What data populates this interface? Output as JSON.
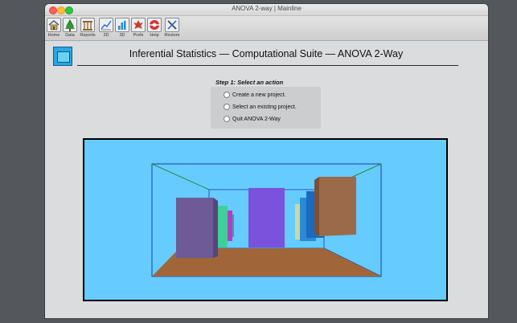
{
  "window": {
    "title": "ANOVA 2-way | Mainline"
  },
  "toolbar": {
    "items": [
      {
        "label": "Home",
        "icon": "home-icon"
      },
      {
        "label": "Data",
        "icon": "tree-icon"
      },
      {
        "label": "Reports",
        "icon": "columns-icon"
      },
      {
        "label": "2D",
        "icon": "line-chart-icon"
      },
      {
        "label": "3D",
        "icon": "bar-chart-icon"
      },
      {
        "label": "Prefs",
        "icon": "leaf-icon"
      },
      {
        "label": "Help",
        "icon": "lifebuoy-icon"
      },
      {
        "label": "Restore",
        "icon": "tools-icon"
      }
    ]
  },
  "header": {
    "title": "Inferential Statistics — Computational Suite — ANOVA 2-Way",
    "logo_icon": "app-logo-icon"
  },
  "step": {
    "heading": "Step 1: Select an action",
    "options": [
      {
        "label": "Create a new project."
      },
      {
        "label": "Select an existing project."
      },
      {
        "label": "Quit ANOVA 2-Way"
      }
    ]
  },
  "scene": {
    "background_color": "#66ccff",
    "floor_color": "#a0663a",
    "box_colors": [
      "#6e5a96",
      "#3fcf9a",
      "#b040c0",
      "#3aa0a8",
      "#7a52dc",
      "#c8d8a0",
      "#2b8ad6",
      "#9a6a4a"
    ]
  }
}
